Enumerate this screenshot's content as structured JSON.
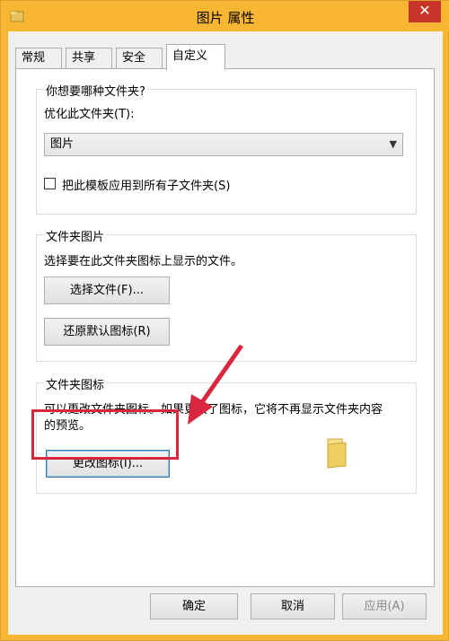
{
  "window": {
    "title": "图片 属性",
    "close_symbol": "✕"
  },
  "tabs": [
    {
      "label": "常规",
      "active": false
    },
    {
      "label": "共享",
      "active": false
    },
    {
      "label": "安全",
      "active": false
    },
    {
      "label": "自定义",
      "active": true
    }
  ],
  "folder_type": {
    "group_label": "你想要哪种文件夹?",
    "optimize_label": "优化此文件夹(T):",
    "selected_option": "图片",
    "apply_subfolders_label": "把此模板应用到所有子文件夹(S)",
    "apply_subfolders_checked": false
  },
  "folder_pictures": {
    "group_label": "文件夹图片",
    "description": "选择要在此文件夹图标上显示的文件。",
    "choose_file_button": "选择文件(F)...",
    "restore_default_button": "还原默认图标(R)"
  },
  "folder_icons": {
    "group_label": "文件夹图标",
    "description_line1": "可以更改文件夹图标。如果更改了图标，它将不再显示文件夹内容",
    "description_line2": "的预览。",
    "change_icon_button": "更改图标(I)..."
  },
  "footer": {
    "ok_button": "确定",
    "cancel_button": "取消",
    "apply_button": "应用(A)"
  },
  "colors": {
    "titlebar": "#f8b632",
    "close": "#c7352b",
    "highlight": "#d9273f"
  }
}
